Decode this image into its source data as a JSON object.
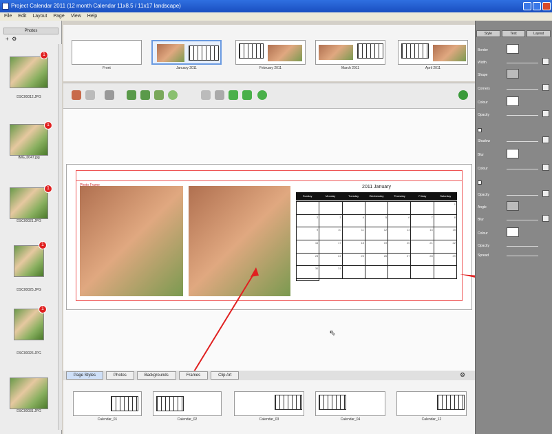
{
  "window": {
    "title": "Project Calendar 2011 (12 month Calendar 11x8.5 / 11x17 landscape)",
    "menu": [
      "File",
      "Edit",
      "Layout",
      "Page",
      "View",
      "Help"
    ]
  },
  "left_panel": {
    "header": "Photos",
    "items": [
      {
        "caption": "DSC00012.JPG",
        "badge": "1"
      },
      {
        "caption": "IMG_0047.jpg",
        "badge": "1"
      },
      {
        "caption": "DSC00021.JPG",
        "badge": "1"
      },
      {
        "caption": "DSC00025.JPG",
        "badge": "1"
      },
      {
        "caption": "DSC00026.JPG",
        "badge": "1"
      },
      {
        "caption": "DSC00031.JPG",
        "badge": ""
      }
    ]
  },
  "top_strip": {
    "pages": [
      "Front",
      "January 2011",
      "February 2011",
      "March 2011",
      "April 2011"
    ]
  },
  "canvas": {
    "hint": "Photo Frame",
    "calendar": {
      "title": "2011  January",
      "weekdays": [
        "Sunday",
        "Monday",
        "Tuesday",
        "Wednesday",
        "Thursday",
        "Friday",
        "Saturday"
      ],
      "days": [
        "",
        "",
        "",
        "",
        "",
        "",
        "1",
        "2",
        "3",
        "4",
        "5",
        "6",
        "7",
        "8",
        "9",
        "10",
        "11",
        "12",
        "13",
        "14",
        "15",
        "16",
        "17",
        "18",
        "19",
        "20",
        "21",
        "22",
        "23",
        "24",
        "25",
        "26",
        "27",
        "28",
        "29",
        "30",
        "31",
        "",
        "",
        "",
        "",
        "",
        ""
      ]
    }
  },
  "tabs": [
    "Page Styles",
    "Photos",
    "Backgrounds",
    "Frames",
    "Clip Art"
  ],
  "bottom_strip": {
    "layouts": [
      "Calendar_01",
      "Calendar_02",
      "Calendar_03",
      "Calendar_04",
      "Calendar_12"
    ]
  },
  "right_panel": {
    "tabs": [
      "Style",
      "Text",
      "Layout"
    ],
    "labels": [
      "Border",
      "Width",
      "Shape",
      "Corners",
      "Colour",
      "Opacity",
      "Shadow",
      "Blur",
      "Colour",
      "Opacity",
      "Glow",
      "Offset",
      "Angle",
      "Blur",
      "Colour",
      "Opacity",
      "Spread"
    ]
  },
  "colors": {
    "titlebar": "#1a4fc0",
    "badge": "#e02020",
    "guide": "#e55555",
    "arrow": "#e02020"
  }
}
